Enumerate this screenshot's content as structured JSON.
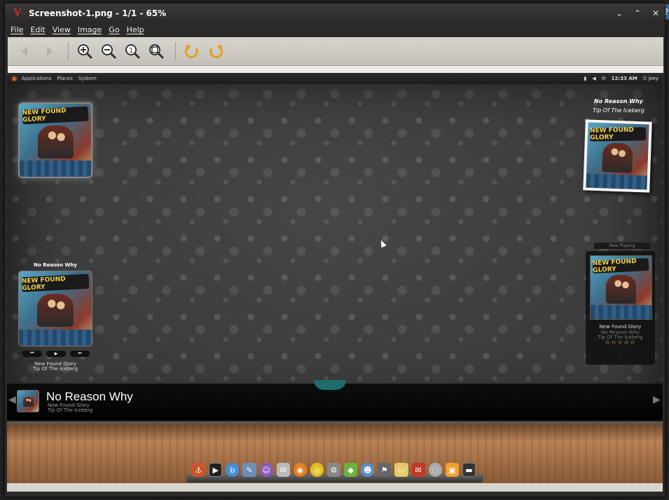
{
  "window": {
    "title": "Screenshot-1.png - 1/1 - 65%",
    "minimize": "⌄",
    "maximize": "⌃",
    "close": "✕",
    "app_logo": "V"
  },
  "menu": {
    "file": "File",
    "edit": "Edit",
    "view": "View",
    "image": "Image",
    "go": "Go",
    "help": "Help"
  },
  "toolbar": {
    "icons": [
      "back-arrow-icon",
      "forward-arrow-icon",
      "zoom-in-icon",
      "zoom-out-icon",
      "zoom-1-icon",
      "zoom-fit-icon",
      "rotate-left-icon",
      "rotate-right-icon"
    ]
  },
  "screenshot": {
    "panel": {
      "applications": "Applications",
      "places": "Places",
      "system": "System",
      "clock": "12:33 AM",
      "user": "joey"
    },
    "top_right": {
      "song": "No Reason Why",
      "album": "Tip Of The Iceberg"
    },
    "left_widget": {
      "song": "No Reason Why",
      "artist": "New Found Glory",
      "album": "Tip Of The Iceberg",
      "prev": "⏮",
      "play": "▶",
      "next": "⏭"
    },
    "now_playing": {
      "label": "Now Playing",
      "artist": "New Found Glory",
      "song": "No Reason Why",
      "album": "Tip Of The Iceberg",
      "stars": "☆☆☆☆☆"
    },
    "bottom_bar": {
      "song": "No Reason Why",
      "artist": "New Found Glory",
      "album": "Tip Of The Iceberg",
      "prev_arrow": "◀",
      "next_arrow": "▶"
    },
    "album_art_text": "NEW FOUND GLORY"
  },
  "colors": {
    "accent_red": "#e2262b",
    "star_gold": "#e8c44a",
    "teal": "#1e6d6b"
  }
}
